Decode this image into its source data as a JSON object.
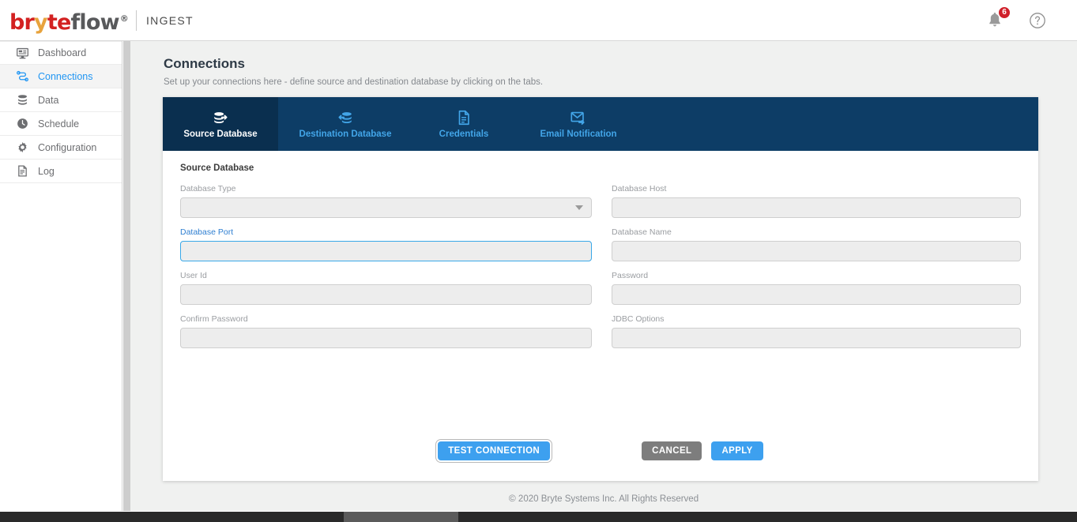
{
  "brand": {
    "logo_b": "b",
    "logo_r": "r",
    "logo_y": "y",
    "logo_te": "te",
    "logo_flow": "flow",
    "logo_registered": "®",
    "app_name": "INGEST"
  },
  "topbar": {
    "notification_count": "6",
    "bell_icon": "bell-icon",
    "help_icon": "help-circle-icon"
  },
  "sidebar": {
    "items": [
      {
        "label": "Dashboard",
        "icon": "dashboard-icon",
        "active": false
      },
      {
        "label": "Connections",
        "icon": "connections-icon",
        "active": true
      },
      {
        "label": "Data",
        "icon": "database-icon",
        "active": false
      },
      {
        "label": "Schedule",
        "icon": "clock-icon",
        "active": false
      },
      {
        "label": "Configuration",
        "icon": "gear-icon",
        "active": false
      },
      {
        "label": "Log",
        "icon": "document-icon",
        "active": false
      }
    ]
  },
  "page": {
    "title": "Connections",
    "subtitle": "Set up your connections here - define source and destination database by clicking on the tabs."
  },
  "tabs": [
    {
      "label": "Source Database",
      "icon": "source-database-icon",
      "active": true
    },
    {
      "label": "Destination Database",
      "icon": "destination-database-icon",
      "active": false
    },
    {
      "label": "Credentials",
      "icon": "credentials-document-icon",
      "active": false
    },
    {
      "label": "Email Notification",
      "icon": "email-notification-icon",
      "active": false
    }
  ],
  "form": {
    "section_title": "Source Database",
    "fields": {
      "database_type": {
        "label": "Database Type",
        "value": "",
        "placeholder": ""
      },
      "database_host": {
        "label": "Database Host",
        "value": "",
        "placeholder": ""
      },
      "database_port": {
        "label": "Database Port",
        "value": "",
        "placeholder": ""
      },
      "database_name": {
        "label": "Database Name",
        "value": "",
        "placeholder": ""
      },
      "user_id": {
        "label": "User Id",
        "value": "",
        "placeholder": ""
      },
      "password": {
        "label": "Password",
        "value": "",
        "placeholder": ""
      },
      "confirm_password": {
        "label": "Confirm Password",
        "value": "",
        "placeholder": ""
      },
      "jdbc_options": {
        "label": "JDBC Options",
        "value": "",
        "placeholder": ""
      }
    }
  },
  "buttons": {
    "test_connection": "TEST CONNECTION",
    "cancel": "CANCEL",
    "apply": "APPLY"
  },
  "footer": {
    "copyright_symbol": "©",
    "text": "2020 Bryte Systems Inc. All Rights Reserved"
  },
  "colors": {
    "brand_red": "#d32121",
    "brand_gold": "#e8a33d",
    "brand_gray": "#58595b",
    "tab_navy": "#0d3d66",
    "tab_navy_active": "#0a2f4f",
    "accent_blue": "#3da0ef",
    "link_blue": "#2196f3",
    "badge_red": "#d0202a",
    "cancel_gray": "#7d7d7d"
  }
}
